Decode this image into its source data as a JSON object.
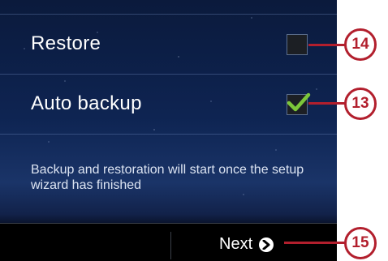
{
  "settings": {
    "restore_label": "Restore",
    "restore_checked": false,
    "auto_backup_label": "Auto backup",
    "auto_backup_checked": true,
    "info_text": "Backup and restoration will start once the setup wizard has finished"
  },
  "footer": {
    "next_label": "Next",
    "next_icon": "chevron-right-circle-icon"
  },
  "callouts": [
    {
      "label": "14",
      "target": "restore-checkbox"
    },
    {
      "label": "13",
      "target": "auto-backup-checkbox"
    },
    {
      "label": "15",
      "target": "next-button"
    }
  ],
  "colors": {
    "callout": "#b21f2d",
    "checkmark": "#7cc63a",
    "background": "#0e2452"
  }
}
